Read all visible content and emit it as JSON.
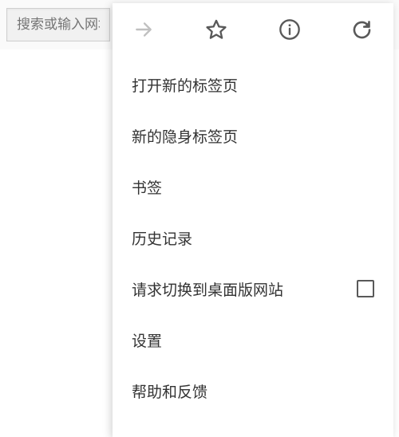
{
  "search": {
    "placeholder": "搜索或输入网址"
  },
  "toolbar": {
    "forward": "forward",
    "star": "bookmark-star",
    "info": "info",
    "reload": "reload"
  },
  "menu": {
    "items": [
      {
        "label": "打开新的标签页",
        "has_checkbox": false
      },
      {
        "label": "新的隐身标签页",
        "has_checkbox": false
      },
      {
        "label": "书签",
        "has_checkbox": false
      },
      {
        "label": "历史记录",
        "has_checkbox": false
      },
      {
        "label": "请求切换到桌面版网站",
        "has_checkbox": true,
        "checked": false
      },
      {
        "label": "设置",
        "has_checkbox": false
      },
      {
        "label": "帮助和反馈",
        "has_checkbox": false
      }
    ]
  }
}
